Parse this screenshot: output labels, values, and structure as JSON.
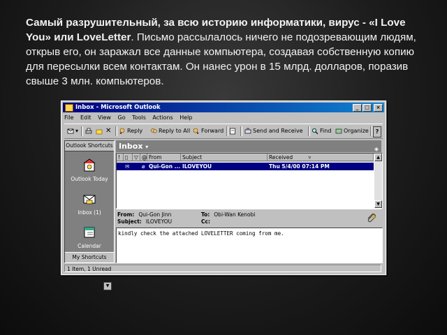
{
  "caption": {
    "bold": "Самый разрушительный, за всю историю информатики, вирус - «I Love You» или LoveLetter",
    "text": ". Письмо рассылалось ничего не подозревающим людям, открыв его, он заражал все данные компьютера, создавая собственную копию для пересылки всем контактам. Он нанес урон в 15 млрд. долларов, поразив свыше 3 млн. компьютеров."
  },
  "window": {
    "title": "Inbox - Microsoft Outlook",
    "controls": [
      "_",
      "□",
      "×"
    ],
    "menu": [
      "File",
      "Edit",
      "View",
      "Go",
      "Tools",
      "Actions",
      "Help"
    ],
    "toolbar": {
      "reply": "Reply",
      "reply_all": "Reply to All",
      "forward": "Forward",
      "send_receive": "Send and Receive",
      "find": "Find",
      "organize": "Organize"
    }
  },
  "shortcuts": {
    "header": "Outlook Shortcuts",
    "items": [
      "Outlook Today",
      "Inbox (1)",
      "Calendar"
    ],
    "footer": "My Shortcuts"
  },
  "inbox": {
    "title": "Inbox",
    "columns": {
      "flag": "!",
      "from": "From",
      "subject": "Subject",
      "received": "Received"
    },
    "messages": [
      {
        "from": "Qui-Gon ...",
        "subject": "ILOVEYOU",
        "received": "Thu 5/4/00 07:14 PM",
        "selected": true
      }
    ]
  },
  "preview": {
    "from_label": "From:",
    "from": "Qui-Gon Jinn",
    "to_label": "To:",
    "to": "Obi-Wan Kenobi",
    "subject_label": "Subject:",
    "subject": "ILOVEYOU",
    "cc_label": "Cc:",
    "cc": "",
    "body": "kindly check the attached LOVELETTER coming from me."
  },
  "status": "1 Item, 1 Unread",
  "colors": {
    "titlebar": "#000080",
    "selection": "#000080",
    "chrome": "#c0c0c0"
  }
}
